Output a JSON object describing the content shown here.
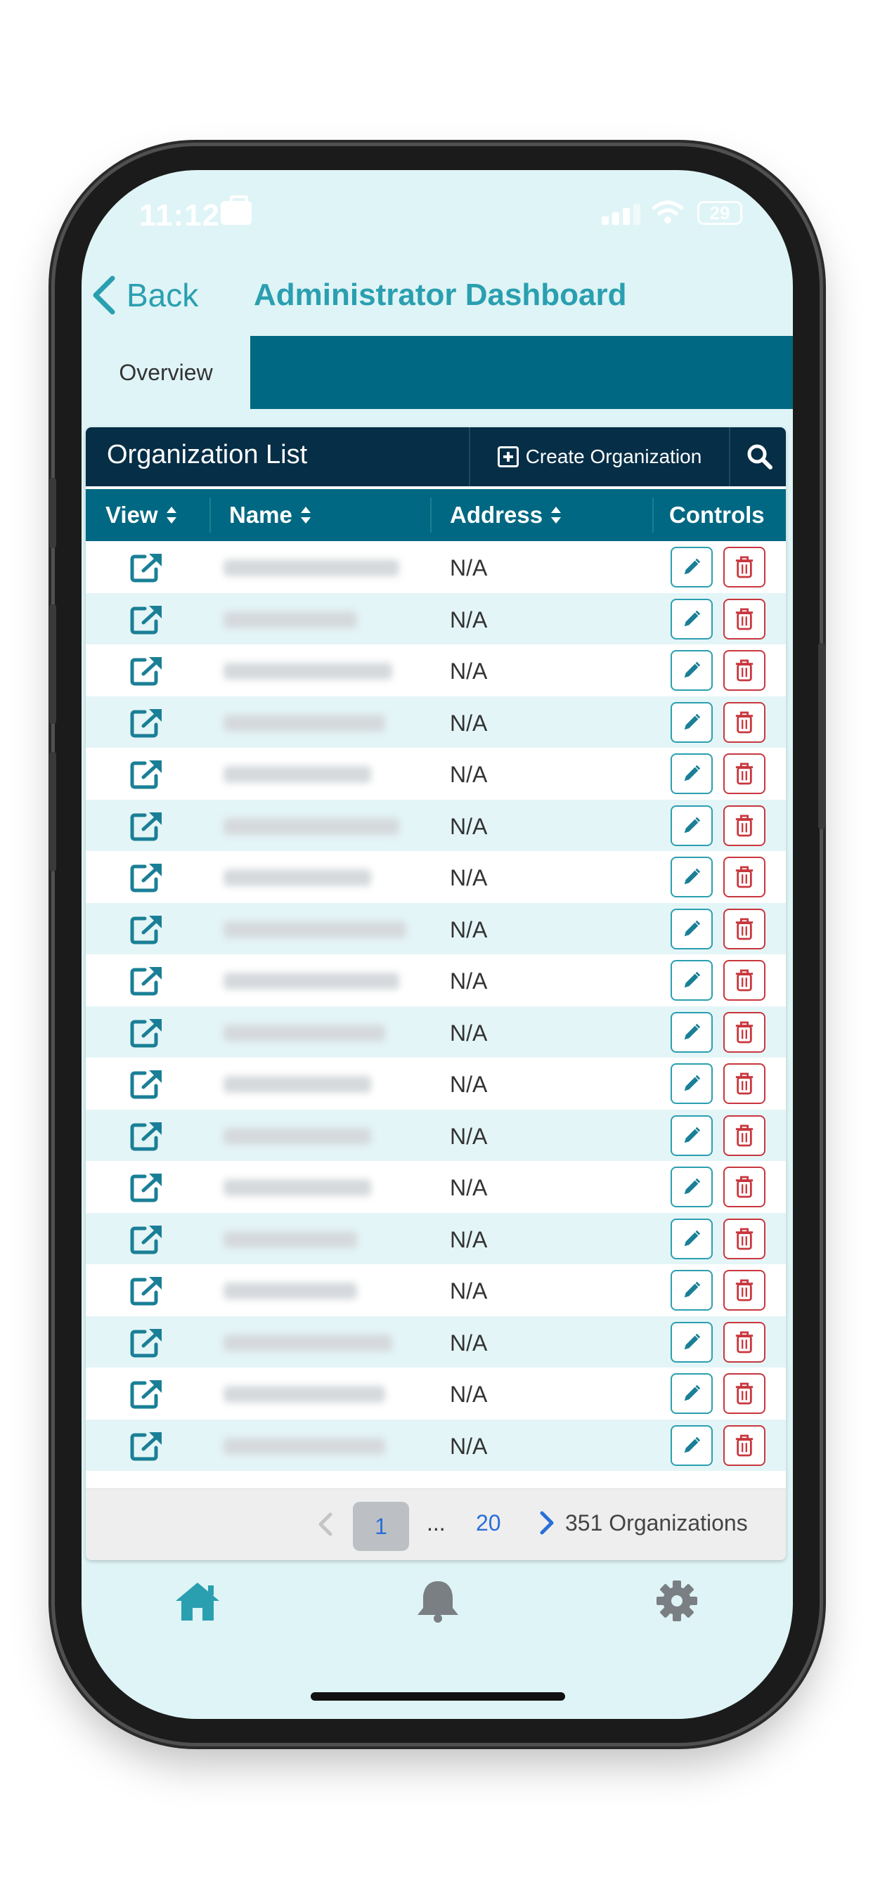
{
  "status_bar": {
    "time": "11:12",
    "battery": "29",
    "icons": [
      "briefcase-icon",
      "signal-icon",
      "wifi-icon",
      "battery-icon"
    ]
  },
  "nav": {
    "back_label": "Back",
    "title": "Administrator Dashboard"
  },
  "tabs": [
    {
      "label": "Overview",
      "active": true
    }
  ],
  "card": {
    "title": "Organization List",
    "create_label": "Create Organization"
  },
  "table": {
    "columns": [
      "View",
      "Name",
      "Address",
      "Controls"
    ],
    "rows": [
      {
        "address": "N/A"
      },
      {
        "address": "N/A"
      },
      {
        "address": "N/A"
      },
      {
        "address": "N/A"
      },
      {
        "address": "N/A"
      },
      {
        "address": "N/A"
      },
      {
        "address": "N/A"
      },
      {
        "address": "N/A"
      },
      {
        "address": "N/A"
      },
      {
        "address": "N/A"
      },
      {
        "address": "N/A"
      },
      {
        "address": "N/A"
      },
      {
        "address": "N/A"
      },
      {
        "address": "N/A"
      },
      {
        "address": "N/A"
      },
      {
        "address": "N/A"
      },
      {
        "address": "N/A"
      },
      {
        "address": "N/A"
      }
    ]
  },
  "pagination": {
    "current_page": "1",
    "ellipsis": "...",
    "last_page": "20",
    "total_label": "351 Organizations"
  },
  "bottom_nav": [
    {
      "icon": "home-icon",
      "active": true
    },
    {
      "icon": "bell-icon",
      "active": false
    },
    {
      "icon": "gear-icon",
      "active": false
    }
  ],
  "colors": {
    "accent": "#2a9fb0",
    "header_dark": "#062e46",
    "table_header": "#006882",
    "danger": "#c8373e",
    "screen_bg": "#dff4f6"
  }
}
